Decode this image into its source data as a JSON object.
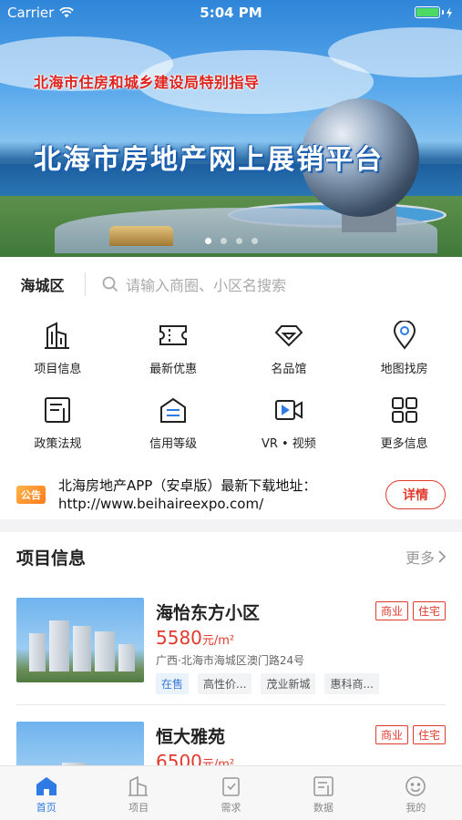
{
  "status_bar": {
    "carrier": "Carrier",
    "time": "5:04 PM"
  },
  "banner": {
    "subtitle": "北海市住房和城乡建设局特别指导",
    "title": "北海市房地产网上展销平台",
    "slide_count": 4,
    "active_slide": 1
  },
  "search": {
    "region": "海城区",
    "placeholder": "请输入商圈、小区名搜索"
  },
  "menu": [
    {
      "label": "项目信息",
      "icon": "building-icon"
    },
    {
      "label": "最新优惠",
      "icon": "ticket-icon"
    },
    {
      "label": "名品馆",
      "icon": "diamond-icon"
    },
    {
      "label": "地图找房",
      "icon": "map-pin-icon"
    },
    {
      "label": "政策法规",
      "icon": "document-icon"
    },
    {
      "label": "信用等级",
      "icon": "house-credit-icon"
    },
    {
      "label": "VR • 视频",
      "icon": "video-icon"
    },
    {
      "label": "更多信息",
      "icon": "grid-icon"
    }
  ],
  "notice": {
    "tag": "公告",
    "text": "北海房地产APP（安卓版）最新下载地址：http://www.beihaireexpo.com/",
    "button": "详情"
  },
  "section": {
    "title": "项目信息",
    "more": "更多"
  },
  "listings": [
    {
      "name": "海怡东方小区",
      "tags": [
        "商业",
        "住宅"
      ],
      "price": "5580",
      "unit": "元/m²",
      "address": "广西·北海市海城区澳门路24号",
      "chips": [
        "在售",
        "高性价...",
        "茂业新城",
        "惠科商..."
      ]
    },
    {
      "name": "恒大雅苑",
      "tags": [
        "商业",
        "住宅"
      ],
      "price": "6500",
      "unit": "元/m²"
    }
  ],
  "tabbar": [
    {
      "label": "首页",
      "icon": "home-icon",
      "active": true
    },
    {
      "label": "项目",
      "icon": "building-tab-icon",
      "active": false
    },
    {
      "label": "需求",
      "icon": "clipboard-icon",
      "active": false
    },
    {
      "label": "数据",
      "icon": "chart-doc-icon",
      "active": false
    },
    {
      "label": "我的",
      "icon": "smiley-icon",
      "active": false
    }
  ],
  "colors": {
    "accent": "#2f7be5",
    "price_red": "#e23b2e",
    "tag_orange": "#ff8a1f"
  }
}
